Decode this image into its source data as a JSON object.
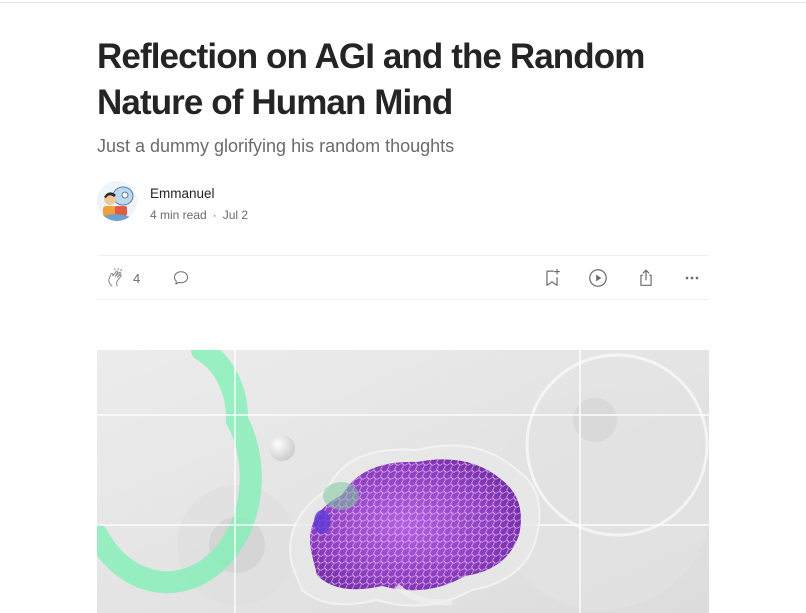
{
  "article": {
    "title": "Reflection on AGI and the Random Nature of Human Mind",
    "subtitle": "Just a dummy glorifying his random thoughts"
  },
  "author": {
    "name": "Emmanuel",
    "read_time": "4 min read",
    "separator": "·",
    "date": "Jul 2"
  },
  "actions": {
    "clap_count": "4",
    "icons": [
      "clap-icon",
      "response-icon",
      "bookmark-add-icon",
      "play-icon",
      "share-icon",
      "more-icon"
    ]
  },
  "colors": {
    "text": "#242424",
    "muted": "#6b6b6b",
    "divider": "#f0f0f0",
    "brain_purple": "#9a45c4",
    "ring_green": "#7cf0b4"
  }
}
